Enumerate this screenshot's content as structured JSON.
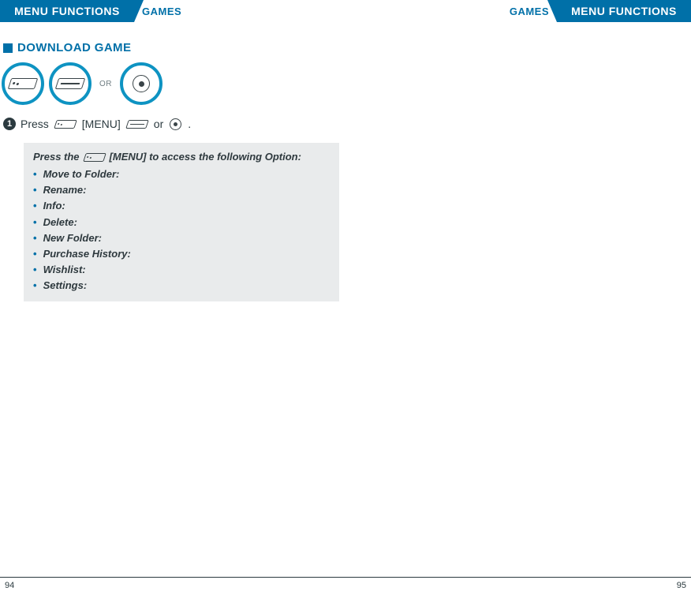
{
  "header": {
    "left_primary": "MENU FUNCTIONS",
    "left_secondary": "GAMES",
    "right_primary": "MENU FUNCTIONS",
    "right_secondary": "GAMES"
  },
  "section": {
    "title": "DOWNLOAD GAME"
  },
  "icons": {
    "or": "OR"
  },
  "step": {
    "num": "1",
    "press": "Press",
    "menu_label": "[MENU]",
    "or": "or",
    "period": "."
  },
  "options": {
    "lead_pre": "Press the",
    "lead_post": "[MENU] to access the following Option:",
    "items": [
      "Move to Folder:",
      "Rename:",
      "Info:",
      "Delete:",
      "New Folder:",
      "Purchase History:",
      "Wishlist:",
      "Settings:"
    ]
  },
  "footer": {
    "left": "94",
    "right": "95"
  }
}
